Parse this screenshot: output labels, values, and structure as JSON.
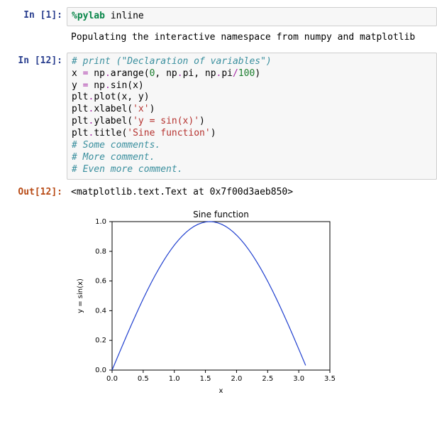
{
  "cells": {
    "c1": {
      "in_prompt": "In [1]:",
      "code_tokens": [
        {
          "cls": "tok-magic",
          "t": "%pylab"
        },
        {
          "cls": "tok-plain",
          "t": " inline"
        }
      ],
      "stream": "Populating the interactive namespace from numpy and matplotlib"
    },
    "c12": {
      "in_prompt": "In [12]:",
      "out_prompt": "Out[12]:",
      "code_lines": [
        [
          {
            "cls": "tok-comment",
            "t": "# print (\"Declaration of variables\")"
          }
        ],
        [
          {
            "cls": "tok-plain",
            "t": "x "
          },
          {
            "cls": "tok-op",
            "t": "="
          },
          {
            "cls": "tok-plain",
            "t": " np"
          },
          {
            "cls": "tok-op",
            "t": "."
          },
          {
            "cls": "tok-plain",
            "t": "arange("
          },
          {
            "cls": "tok-num",
            "t": "0"
          },
          {
            "cls": "tok-plain",
            "t": ", np"
          },
          {
            "cls": "tok-op",
            "t": "."
          },
          {
            "cls": "tok-plain",
            "t": "pi, np"
          },
          {
            "cls": "tok-op",
            "t": "."
          },
          {
            "cls": "tok-plain",
            "t": "pi"
          },
          {
            "cls": "tok-op",
            "t": "/"
          },
          {
            "cls": "tok-num",
            "t": "100"
          },
          {
            "cls": "tok-plain",
            "t": ")"
          }
        ],
        [
          {
            "cls": "tok-plain",
            "t": "y "
          },
          {
            "cls": "tok-op",
            "t": "="
          },
          {
            "cls": "tok-plain",
            "t": " np"
          },
          {
            "cls": "tok-op",
            "t": "."
          },
          {
            "cls": "tok-plain",
            "t": "sin(x)"
          }
        ],
        [
          {
            "cls": "tok-plain",
            "t": "plt"
          },
          {
            "cls": "tok-op",
            "t": "."
          },
          {
            "cls": "tok-plain",
            "t": "plot(x, y)"
          }
        ],
        [
          {
            "cls": "tok-plain",
            "t": "plt"
          },
          {
            "cls": "tok-op",
            "t": "."
          },
          {
            "cls": "tok-plain",
            "t": "xlabel("
          },
          {
            "cls": "tok-str",
            "t": "'x'"
          },
          {
            "cls": "tok-plain",
            "t": ")"
          }
        ],
        [
          {
            "cls": "tok-plain",
            "t": "plt"
          },
          {
            "cls": "tok-op",
            "t": "."
          },
          {
            "cls": "tok-plain",
            "t": "ylabel("
          },
          {
            "cls": "tok-str",
            "t": "'y = sin(x)'"
          },
          {
            "cls": "tok-plain",
            "t": ")"
          }
        ],
        [
          {
            "cls": "tok-plain",
            "t": "plt"
          },
          {
            "cls": "tok-op",
            "t": "."
          },
          {
            "cls": "tok-plain",
            "t": "title("
          },
          {
            "cls": "tok-str",
            "t": "'Sine function'"
          },
          {
            "cls": "tok-plain",
            "t": ")"
          }
        ],
        [
          {
            "cls": "tok-comment",
            "t": "# Some comments."
          }
        ],
        [
          {
            "cls": "tok-comment",
            "t": "# More comment."
          }
        ],
        [
          {
            "cls": "tok-comment",
            "t": "# Even more comment."
          }
        ]
      ],
      "out_text": "<matplotlib.text.Text at 0x7f00d3aeb850>"
    }
  },
  "chart_data": {
    "type": "line",
    "title": "Sine function",
    "xlabel": "x",
    "ylabel": "y = sin(x)",
    "xlim": [
      0.0,
      3.5
    ],
    "ylim": [
      0.0,
      1.0
    ],
    "xticks": [
      0.0,
      0.5,
      1.0,
      1.5,
      2.0,
      2.5,
      3.0,
      3.5
    ],
    "yticks": [
      0.0,
      0.2,
      0.4,
      0.6,
      0.8,
      1.0
    ],
    "x": [
      0.0,
      0.0628,
      0.1257,
      0.1885,
      0.2513,
      0.3142,
      0.377,
      0.4398,
      0.5027,
      0.5655,
      0.6283,
      0.6912,
      0.754,
      0.8168,
      0.8796,
      0.9425,
      1.0053,
      1.0681,
      1.131,
      1.1938,
      1.2566,
      1.3195,
      1.3823,
      1.4451,
      1.508,
      1.5708,
      1.6336,
      1.6965,
      1.7593,
      1.8221,
      1.885,
      1.9478,
      2.0106,
      2.0735,
      2.1363,
      2.1991,
      2.2619,
      2.3248,
      2.3876,
      2.4504,
      2.5133,
      2.5761,
      2.6389,
      2.7018,
      2.7646,
      2.8274,
      2.8903,
      2.9531,
      3.0159,
      3.0788,
      3.1102
    ],
    "y": [
      0.0,
      0.0628,
      0.1253,
      0.1874,
      0.2487,
      0.309,
      0.3681,
      0.4258,
      0.4818,
      0.5358,
      0.5878,
      0.6374,
      0.6845,
      0.729,
      0.7705,
      0.809,
      0.8443,
      0.8763,
      0.9048,
      0.9298,
      0.9511,
      0.9686,
      0.9823,
      0.9921,
      0.998,
      1.0,
      0.998,
      0.9921,
      0.9823,
      0.9686,
      0.9511,
      0.9298,
      0.9048,
      0.8763,
      0.8443,
      0.809,
      0.7705,
      0.729,
      0.6845,
      0.6374,
      0.5878,
      0.5358,
      0.4818,
      0.4258,
      0.3681,
      0.309,
      0.2487,
      0.1874,
      0.1253,
      0.0628,
      0.0314
    ]
  }
}
